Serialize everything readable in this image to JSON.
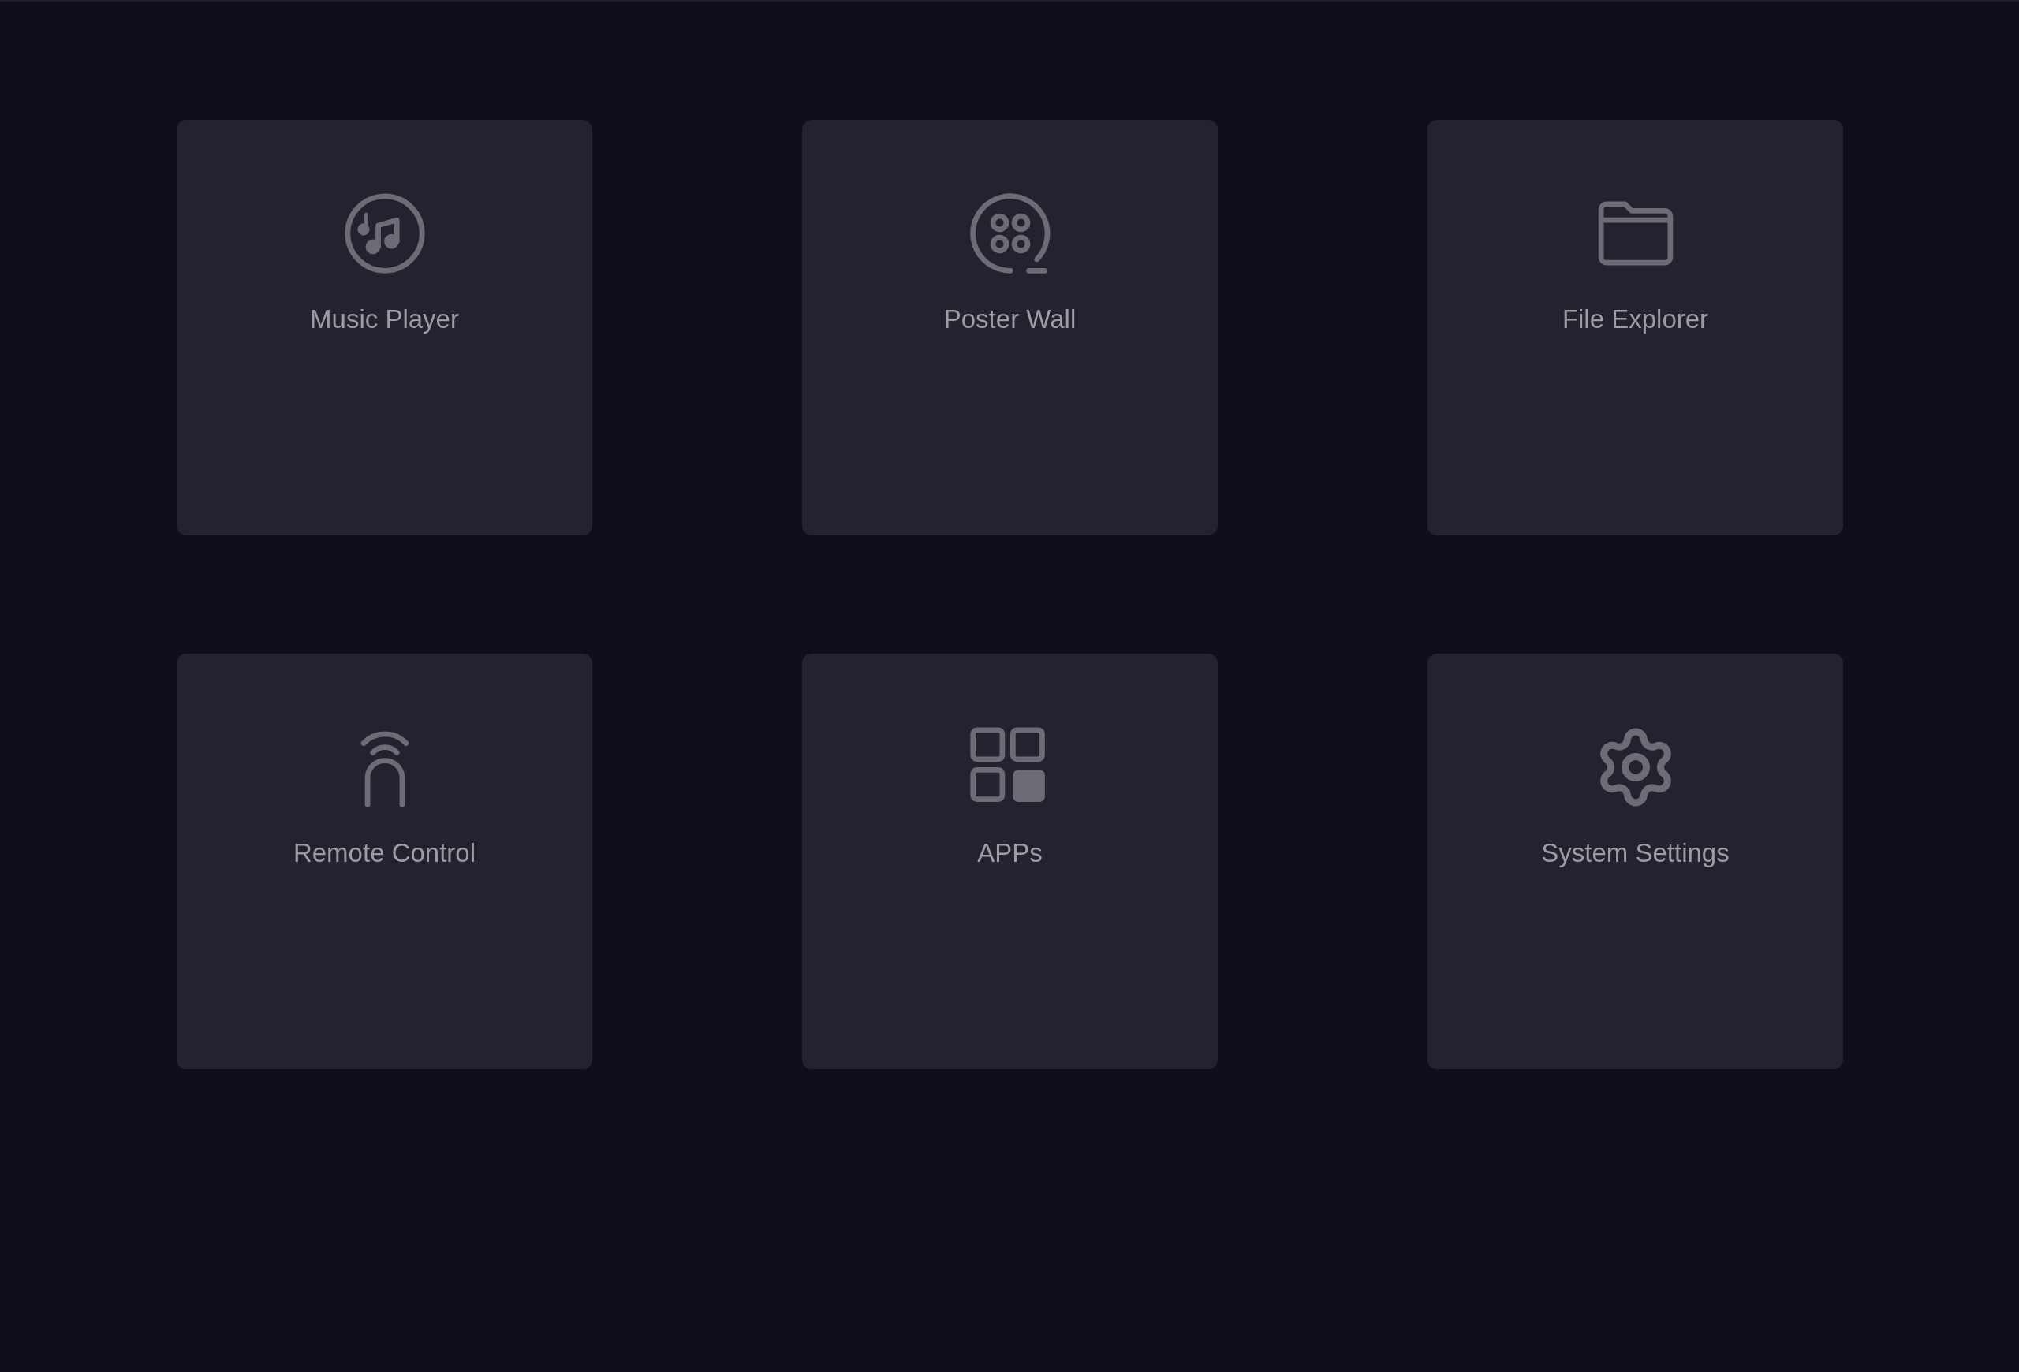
{
  "tiles": [
    {
      "kind": "music",
      "label": "Music Player"
    },
    {
      "kind": "film",
      "label": "Poster Wall"
    },
    {
      "kind": "folder",
      "label": "File Explorer"
    },
    {
      "kind": "remote",
      "label": "Remote Control"
    },
    {
      "kind": "apps",
      "label": "APPs"
    },
    {
      "kind": "settings",
      "label": "System Settings"
    }
  ]
}
